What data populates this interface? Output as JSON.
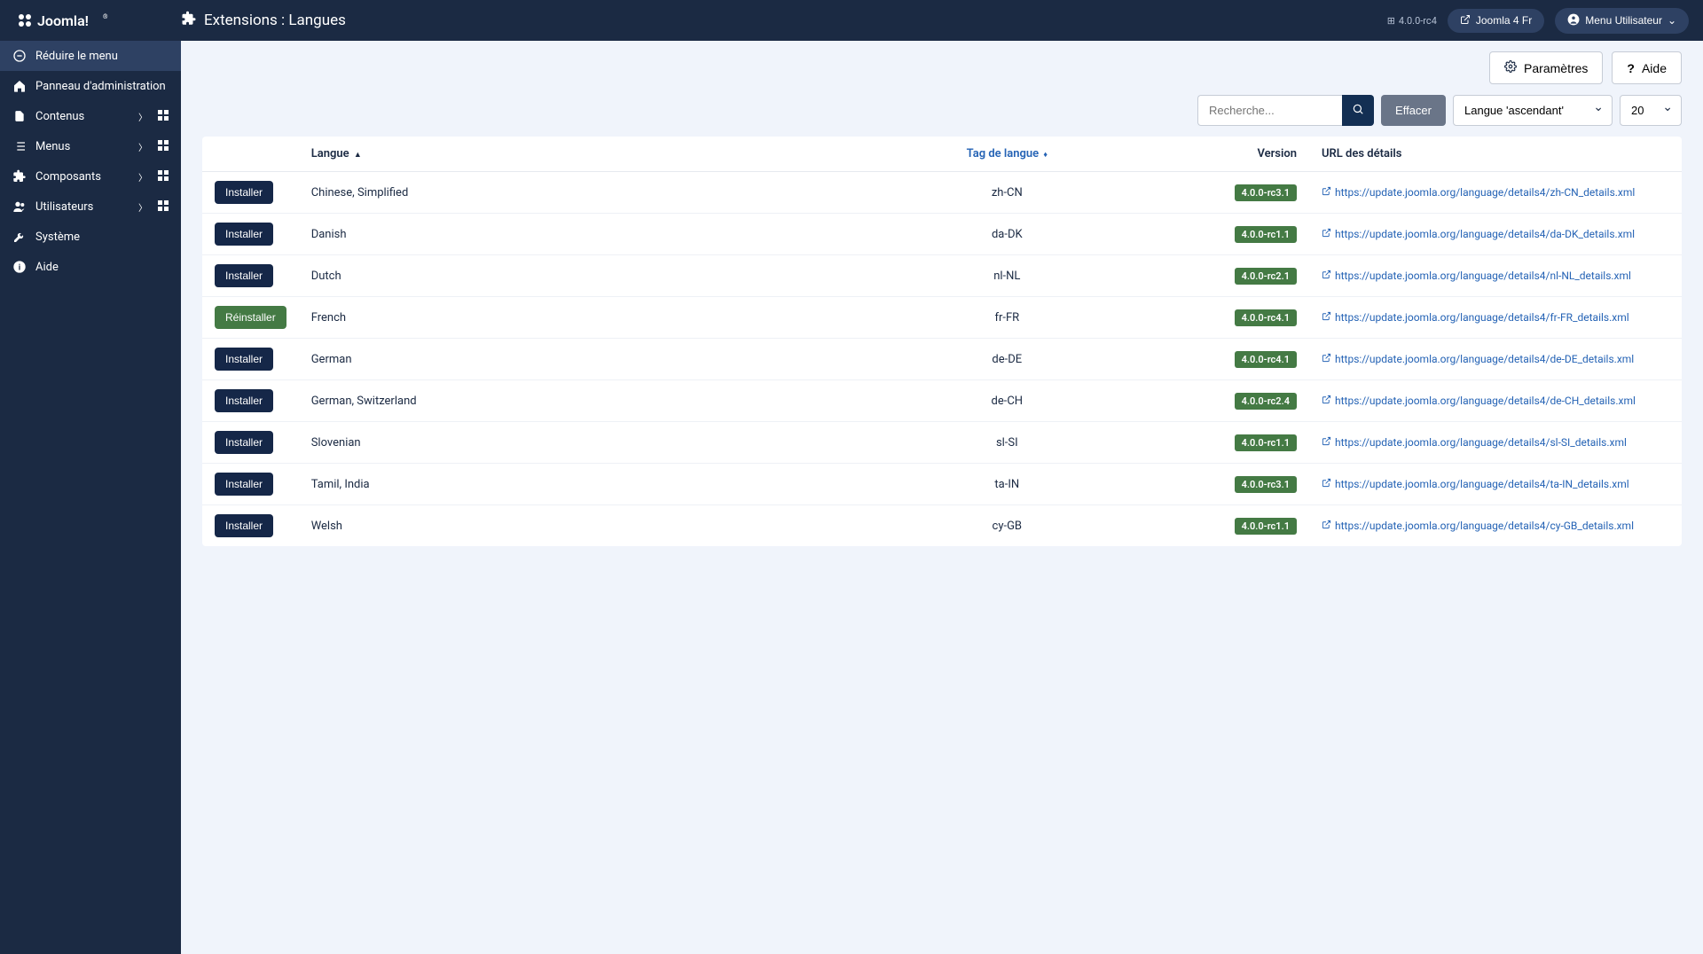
{
  "header": {
    "logo_text": "Joomla!",
    "page_title": "Extensions : Langues",
    "version": "4.0.0-rc4",
    "site_name": "Joomla 4 Fr",
    "user_menu": "Menu Utilisateur"
  },
  "sidebar": {
    "items": [
      {
        "label": "Réduire le menu",
        "icon": "collapse-icon",
        "has_sub": false
      },
      {
        "label": "Panneau d'administration",
        "icon": "home-icon",
        "has_sub": false
      },
      {
        "label": "Contenus",
        "icon": "file-icon",
        "has_sub": true
      },
      {
        "label": "Menus",
        "icon": "list-icon",
        "has_sub": true
      },
      {
        "label": "Composants",
        "icon": "puzzle-icon",
        "has_sub": true
      },
      {
        "label": "Utilisateurs",
        "icon": "users-icon",
        "has_sub": true
      },
      {
        "label": "Système",
        "icon": "wrench-icon",
        "has_sub": false
      },
      {
        "label": "Aide",
        "icon": "info-icon",
        "has_sub": false
      }
    ]
  },
  "toolbar": {
    "options": "Paramètres",
    "help": "Aide"
  },
  "filters": {
    "search_placeholder": "Recherche...",
    "clear": "Effacer",
    "sort": "Langue 'ascendant'",
    "limit": "20"
  },
  "table": {
    "headers": {
      "language": "Langue",
      "tag": "Tag de langue",
      "version": "Version",
      "url": "URL des détails"
    },
    "install_label": "Installer",
    "reinstall_label": "Réinstaller",
    "rows": [
      {
        "reinstall": false,
        "name": "Chinese, Simplified",
        "tag": "zh-CN",
        "version": "4.0.0-rc3.1",
        "url": "https://update.joomla.org/language/details4/zh-CN_details.xml"
      },
      {
        "reinstall": false,
        "name": "Danish",
        "tag": "da-DK",
        "version": "4.0.0-rc1.1",
        "url": "https://update.joomla.org/language/details4/da-DK_details.xml"
      },
      {
        "reinstall": false,
        "name": "Dutch",
        "tag": "nl-NL",
        "version": "4.0.0-rc2.1",
        "url": "https://update.joomla.org/language/details4/nl-NL_details.xml"
      },
      {
        "reinstall": true,
        "name": "French",
        "tag": "fr-FR",
        "version": "4.0.0-rc4.1",
        "url": "https://update.joomla.org/language/details4/fr-FR_details.xml"
      },
      {
        "reinstall": false,
        "name": "German",
        "tag": "de-DE",
        "version": "4.0.0-rc4.1",
        "url": "https://update.joomla.org/language/details4/de-DE_details.xml"
      },
      {
        "reinstall": false,
        "name": "German, Switzerland",
        "tag": "de-CH",
        "version": "4.0.0-rc2.4",
        "url": "https://update.joomla.org/language/details4/de-CH_details.xml"
      },
      {
        "reinstall": false,
        "name": "Slovenian",
        "tag": "sl-SI",
        "version": "4.0.0-rc1.1",
        "url": "https://update.joomla.org/language/details4/sl-SI_details.xml"
      },
      {
        "reinstall": false,
        "name": "Tamil, India",
        "tag": "ta-IN",
        "version": "4.0.0-rc3.1",
        "url": "https://update.joomla.org/language/details4/ta-IN_details.xml"
      },
      {
        "reinstall": false,
        "name": "Welsh",
        "tag": "cy-GB",
        "version": "4.0.0-rc1.1",
        "url": "https://update.joomla.org/language/details4/cy-GB_details.xml"
      }
    ]
  }
}
